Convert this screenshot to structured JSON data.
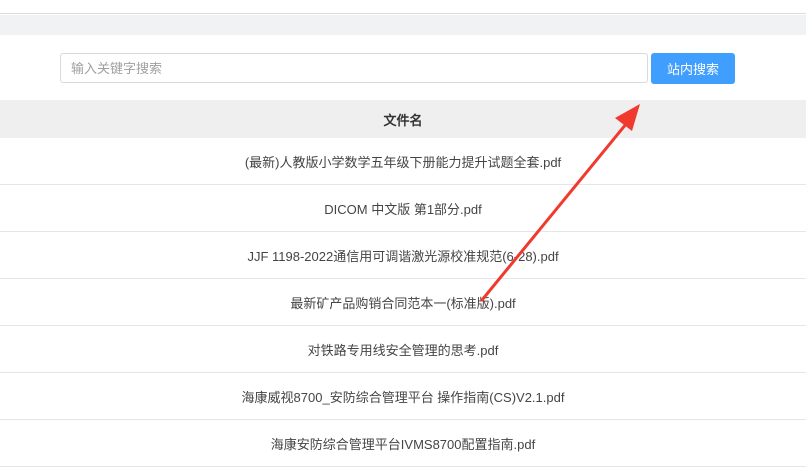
{
  "search": {
    "placeholder": "输入关键字搜索",
    "value": "",
    "button_label": "站内搜索"
  },
  "table": {
    "header": "文件名",
    "rows": [
      "(最新)人教版小学数学五年级下册能力提升试题全套.pdf",
      "DICOM 中文版 第1部分.pdf",
      "JJF 1198-2022通信用可调谐激光源校准规范(6-28).pdf",
      "最新矿产品购销合同范本一(标准版).pdf",
      "对铁路专用线安全管理的思考.pdf",
      "海康威视8700_安防综合管理平台 操作指南(CS)V2.1.pdf",
      "海康安防综合管理平台IVMS8700配置指南.pdf"
    ]
  },
  "colors": {
    "accent": "#409eff",
    "annotation_arrow": "#f03a2e"
  }
}
